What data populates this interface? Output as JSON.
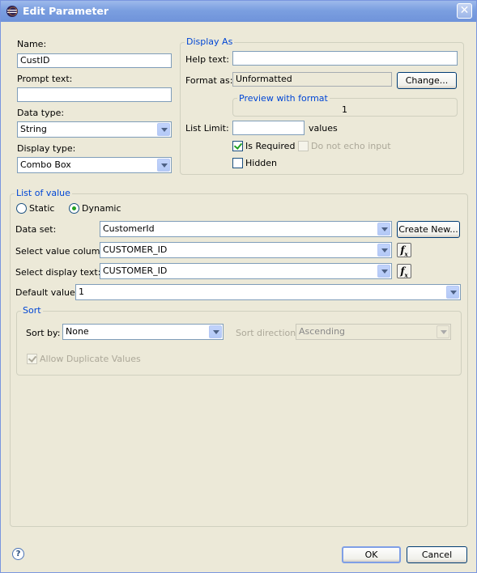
{
  "window": {
    "title": "Edit Parameter",
    "close": "✕"
  },
  "left": {
    "name_label": "Name:",
    "name_value": "CustID",
    "prompt_label": "Prompt text:",
    "prompt_value": "",
    "data_type_label": "Data type:",
    "data_type_value": "String",
    "display_type_label": "Display type:",
    "display_type_value": "Combo Box"
  },
  "display_as": {
    "title": "Display As",
    "help_label": "Help text:",
    "help_value": "",
    "format_label": "Format as:",
    "format_value": "Unformatted",
    "change_button": "Change...",
    "preview_title": "Preview with format",
    "preview_value": "1",
    "list_limit_label": "List Limit:",
    "list_limit_value": "",
    "values_label": "values",
    "is_required_label": "Is Required",
    "is_required_checked": true,
    "no_echo_label": "Do not echo input",
    "hidden_label": "Hidden"
  },
  "list_of_value": {
    "title": "List of value",
    "static_label": "Static",
    "dynamic_label": "Dynamic",
    "selected": "Dynamic",
    "dataset_label": "Data set:",
    "dataset_value": "CustomerId",
    "create_new_button": "Create New...",
    "value_column_label": "Select value column:",
    "value_column_value": "CUSTOMER_ID",
    "display_text_label": "Select display text:",
    "display_text_value": "CUSTOMER_ID",
    "default_label": "Default value:",
    "default_value": "1",
    "fx_label": "f",
    "fx_sub": "x"
  },
  "sort": {
    "title": "Sort",
    "sort_by_label": "Sort by:",
    "sort_by_value": "None",
    "direction_label": "Sort direction:",
    "direction_value": "Ascending",
    "allow_dup_label": "Allow Duplicate Values",
    "allow_dup_checked": true
  },
  "footer": {
    "help": "?",
    "ok": "OK",
    "cancel": "Cancel"
  }
}
